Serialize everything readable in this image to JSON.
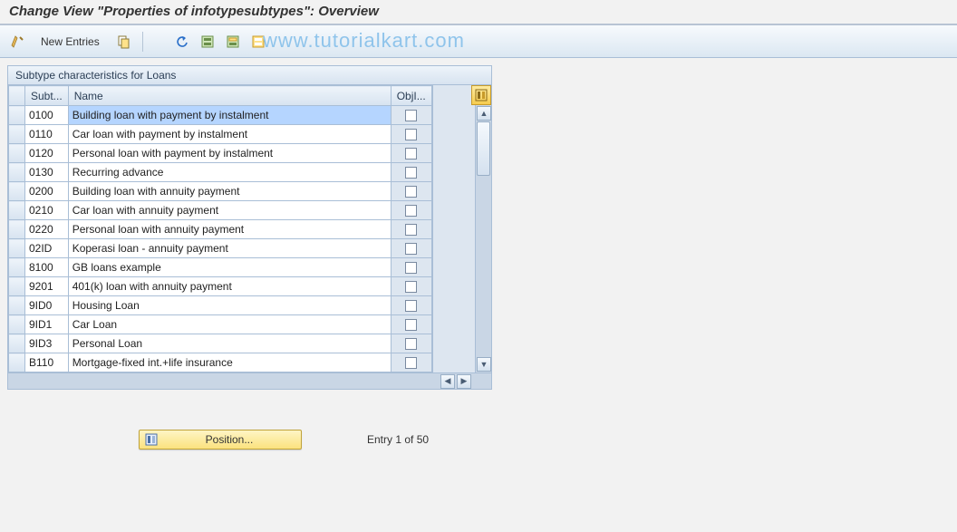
{
  "title": "Change View \"Properties of infotypesubtypes\": Overview",
  "toolbar": {
    "new_entries": "New Entries"
  },
  "watermark": "www.tutorialkart.com",
  "panel": {
    "title": "Subtype characteristics for Loans",
    "columns": {
      "sub": "Subt...",
      "name": "Name",
      "obj": "ObjI..."
    }
  },
  "rows": [
    {
      "sub": "0100",
      "name": "Building loan with payment by instalment",
      "obj": false,
      "sel": true
    },
    {
      "sub": "0110",
      "name": "Car loan with payment by instalment",
      "obj": false
    },
    {
      "sub": "0120",
      "name": "Personal loan with payment by instalment",
      "obj": false
    },
    {
      "sub": "0130",
      "name": "Recurring advance",
      "obj": false
    },
    {
      "sub": "0200",
      "name": "Building loan with annuity payment",
      "obj": false
    },
    {
      "sub": "0210",
      "name": "Car loan with annuity payment",
      "obj": false
    },
    {
      "sub": "0220",
      "name": "Personal loan with annuity payment",
      "obj": false
    },
    {
      "sub": "02ID",
      "name": "Koperasi loan - annuity payment",
      "obj": false
    },
    {
      "sub": "8100",
      "name": "GB loans example",
      "obj": false
    },
    {
      "sub": "9201",
      "name": "401(k) loan with annuity payment",
      "obj": false
    },
    {
      "sub": "9ID0",
      "name": "Housing Loan",
      "obj": false
    },
    {
      "sub": "9ID1",
      "name": "Car Loan",
      "obj": false
    },
    {
      "sub": "9ID3",
      "name": "Personal Loan",
      "obj": false
    },
    {
      "sub": "B110",
      "name": "Mortgage-fixed int.+life insurance",
      "obj": false
    }
  ],
  "footer": {
    "position": "Position...",
    "entry_text": "Entry 1 of 50"
  }
}
